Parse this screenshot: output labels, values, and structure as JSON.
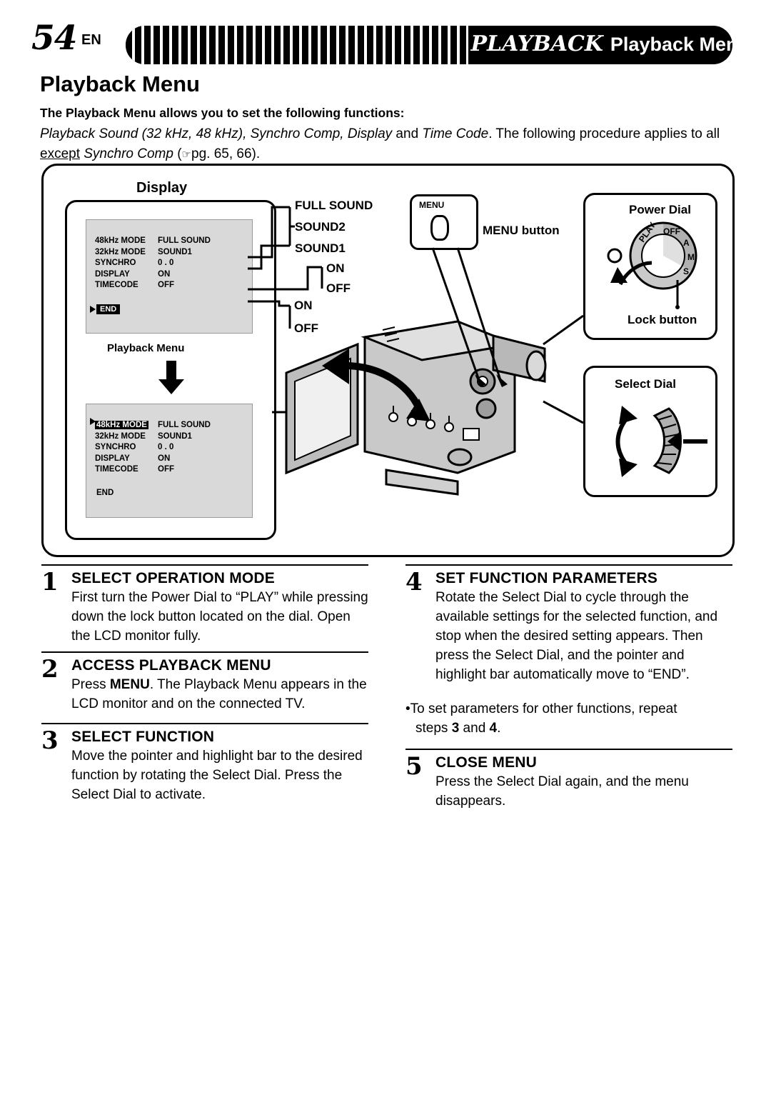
{
  "header": {
    "page_number": "54",
    "page_lang": "EN",
    "section": "PLAYBACK",
    "section_sub": "Playback Menu"
  },
  "title": "Playback Menu",
  "intro": {
    "bold_line": "The Playback Menu allows you to set the following functions:",
    "line1_a": "Playback Sound (32 kHz, 48 kHz), Synchro Comp, Display",
    "line1_b": " and ",
    "line1_c": "Time Code",
    "line1_d": ". The following procedure applies",
    "line2_a": "to all ",
    "line2_b": "except",
    "line2_c": " Synchro Comp",
    "line2_d": " (",
    "line2_e": "pg. 65, 66)."
  },
  "figure": {
    "display_label": "Display",
    "playback_menu_caption": "Playback Menu",
    "screen1": {
      "rows": [
        {
          "label": "48kHz  MODE",
          "value": "FULL SOUND"
        },
        {
          "label": "32kHz  MODE",
          "value": "SOUND1"
        },
        {
          "label": "SYNCHRO",
          "value": "0 . 0"
        },
        {
          "label": "DISPLAY",
          "value": "ON"
        },
        {
          "label": "TIMECODE",
          "value": "OFF"
        }
      ],
      "end": "END"
    },
    "screen2": {
      "rows": [
        {
          "label": "48kHz  MODE",
          "value": "FULL SOUND",
          "highlight": true
        },
        {
          "label": "32kHz  MODE",
          "value": "SOUND1"
        },
        {
          "label": "SYNCHRO",
          "value": "0 . 0"
        },
        {
          "label": "DISPLAY",
          "value": "ON"
        },
        {
          "label": "TIMECODE",
          "value": "OFF"
        }
      ],
      "end": "END"
    },
    "options": {
      "full_sound": "FULL SOUND",
      "sound2": "SOUND2",
      "sound1": "SOUND1",
      "on_1": "ON",
      "off_1": "OFF",
      "on_2": "ON",
      "off_2": "OFF"
    },
    "menu_button_box_label": "MENU",
    "menu_button_label": "MENU button",
    "power_dial_label": "Power Dial",
    "lock_button_label": "Lock button",
    "select_dial_label": "Select Dial",
    "dial_marks": {
      "play": "PLAY",
      "off": "OFF",
      "a": "A",
      "m": "M",
      "s": "S"
    }
  },
  "steps": [
    {
      "num": "1",
      "heading": "SELECT OPERATION MODE",
      "body": "First turn the Power Dial to “PLAY” while pressing down the lock button located on the dial. Open the LCD monitor fully."
    },
    {
      "num": "2",
      "heading": "ACCESS PLAYBACK MENU",
      "body_a": "Press ",
      "body_b": "MENU",
      "body_c": ". The Playback Menu appears in the LCD monitor and on the connected TV."
    },
    {
      "num": "3",
      "heading": "SELECT FUNCTION",
      "body": "Move the pointer and highlight bar to the desired function by rotating the Select Dial. Press the Select Dial to activate."
    },
    {
      "num": "4",
      "heading": "SET FUNCTION PARAMETERS",
      "body": "Rotate the Select Dial to cycle through the available settings for the selected function, and stop when the desired setting appears. Then press the Select Dial, and the pointer and highlight bar automatically move to “END”."
    },
    {
      "num": "5",
      "heading": "CLOSE MENU",
      "body": "Press the Select Dial again, and the menu disappears."
    }
  ],
  "note": {
    "text_a": "•To set parameters for other functions, repeat",
    "text_b": "steps ",
    "text_c": "3",
    "text_d": " and ",
    "text_e": "4",
    "text_f": "."
  }
}
